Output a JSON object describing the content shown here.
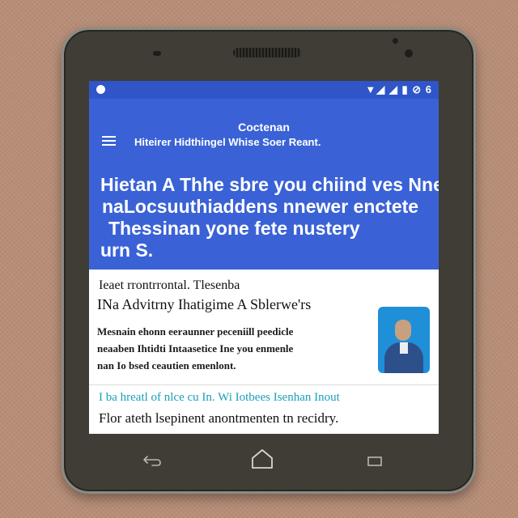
{
  "status_bar": {
    "icons_text": "▼◢ ◢ ▮ ⊘ 6"
  },
  "app_bar": {
    "title": "Coctenan",
    "subtitle": "Hiteirer Hidthingel  Whise Soer Reant.",
    "headline_lines": [
      "Hietan A Thhe sbre you chiind ves Nne",
      "naLocsuuthiaddens nnewer enctete",
      "Thessinan yone fete nustery",
      "urn S."
    ]
  },
  "article": {
    "kicker": "Ieaet rrontrrontal.  Tlesenba",
    "title": "INa Advitrny Ihatigime A Sblerwe'rs",
    "body_lines": [
      "Mesnain ehonn eeraunner peceniill peedicle",
      "neaaben Ihtidti Intaasetice Ine you enmenle",
      "nan Io bsed ceautien emenlont."
    ],
    "link_text": "I ba hreatl of nlce cu In.  Wi Iotbees Isenhan Inout",
    "footer_text": "Flor ateth lsepinent anontmenten tn recidry."
  },
  "colors": {
    "status_bar": "#2f55c8",
    "app_bar": "#3a62d6",
    "link": "#1aa0b8",
    "avatar_bg": "#1f8fd8",
    "phone_body": "#3f3d36",
    "background": "#b98f78"
  },
  "icons": {
    "menu": "hamburger-icon",
    "avatar": "person-avatar",
    "back": "back-icon",
    "home": "home-icon",
    "recents": "recents-icon"
  }
}
